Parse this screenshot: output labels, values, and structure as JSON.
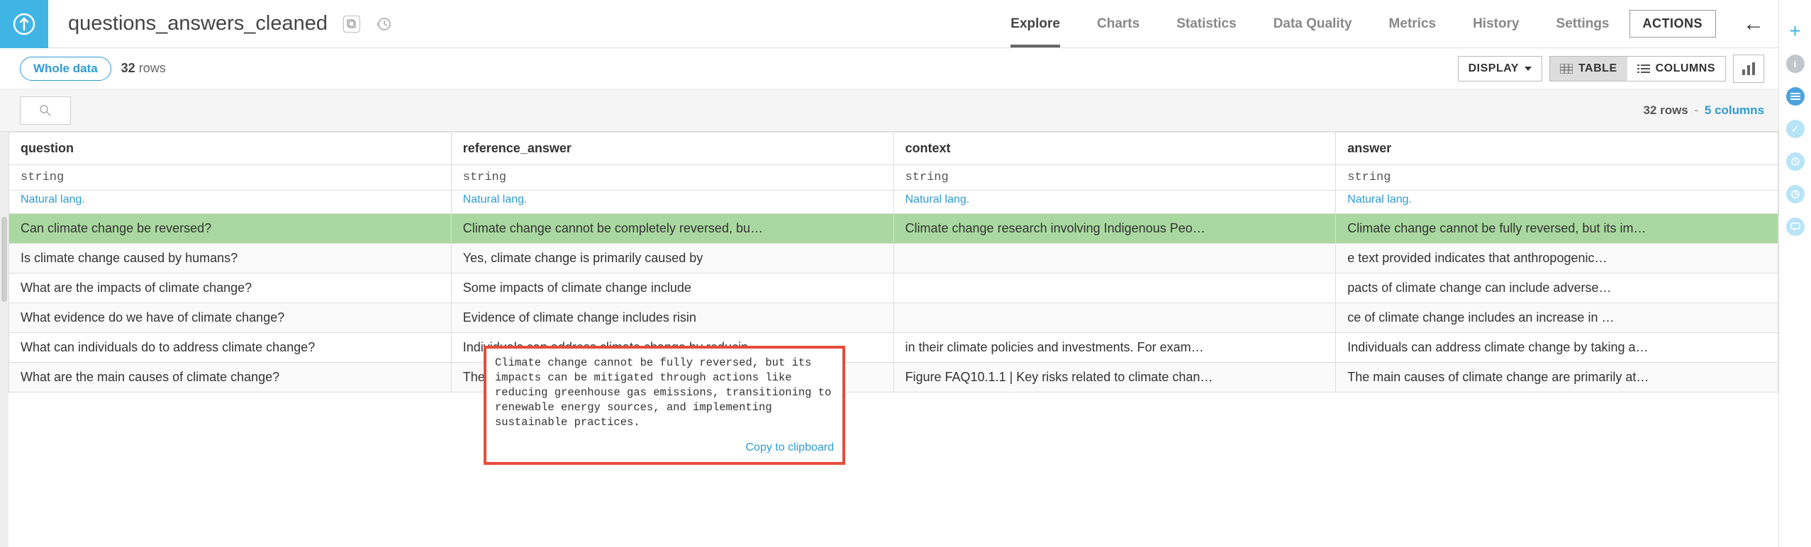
{
  "header": {
    "dataset_name": "questions_answers_cleaned",
    "nav": [
      "Explore",
      "Charts",
      "Statistics",
      "Data Quality",
      "Metrics",
      "History",
      "Settings"
    ],
    "active_nav": 0,
    "actions_label": "ACTIONS"
  },
  "toolbar": {
    "whole_data_label": "Whole data",
    "row_count_num": "32",
    "row_count_word": "rows",
    "display_label": "DISPLAY",
    "table_label": "TABLE",
    "columns_label": "COLUMNS"
  },
  "filterbar": {
    "rows_text": "32 rows",
    "cols_text": "5 columns"
  },
  "columns": [
    {
      "name": "question",
      "type": "string",
      "nat": "Natural lang."
    },
    {
      "name": "reference_answer",
      "type": "string",
      "nat": "Natural lang."
    },
    {
      "name": "context",
      "type": "string",
      "nat": "Natural lang."
    },
    {
      "name": "answer",
      "type": "string",
      "nat": "Natural lang."
    }
  ],
  "rows": [
    {
      "highlight": true,
      "cells": [
        "Can climate change be reversed?",
        "Climate change cannot be completely reversed, bu…",
        "Climate change research involving Indigenous Peo…",
        "Climate change cannot be fully reversed, but its im…"
      ]
    },
    {
      "cells": [
        "Is climate change caused by humans?",
        "Yes, climate change is primarily caused by",
        "",
        "e text provided indicates that anthropogenic…"
      ]
    },
    {
      "cells": [
        "What are the impacts of climate change?",
        "Some impacts of climate change include",
        "",
        "pacts of climate change can include adverse…"
      ]
    },
    {
      "cells": [
        "What evidence do we have of climate change?",
        "Evidence of climate change includes risin",
        "",
        "ce of climate change includes an increase in …"
      ]
    },
    {
      "cells": [
        "What can individuals do to address climate change?",
        "Individuals can address climate change by reducin…",
        "in their climate policies and investments. For exam…",
        "Individuals can address climate change by taking a…"
      ]
    },
    {
      "cells": [
        "What are the main causes of climate change?",
        "The main causes of climate change are human acti…",
        "Figure FAQ10.1.1 | Key risks related to climate chan…",
        "The main causes of climate change are primarily at…"
      ]
    }
  ],
  "tooltip": {
    "text": "Climate change cannot be fully reversed, but its impacts can be mitigated through actions like reducing greenhouse gas emissions, transitioning to renewable energy sources, and implementing sustainable practices.",
    "copy_label": "Copy to clipboard"
  }
}
